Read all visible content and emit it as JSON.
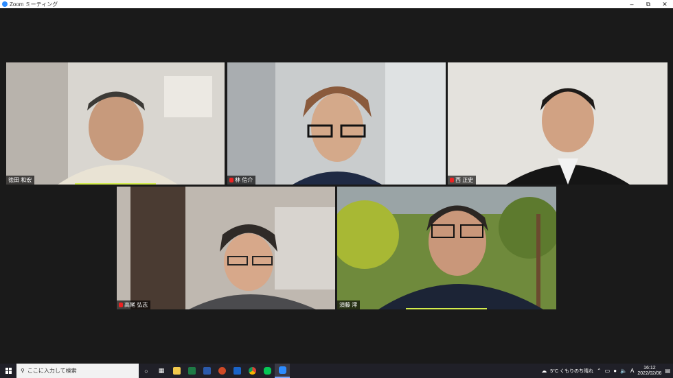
{
  "window": {
    "title": "Zoom ミーティング",
    "minimize": "–",
    "maximize": "⧉",
    "close": "✕"
  },
  "participants": [
    {
      "name": "徳田 和宏",
      "muted": false,
      "active": false
    },
    {
      "name": "林 信介",
      "muted": true,
      "active": false
    },
    {
      "name": "西 正史",
      "muted": true,
      "active": true
    },
    {
      "name": "高尾 弘志",
      "muted": true,
      "active": false
    },
    {
      "name": "須藤 澪",
      "muted": false,
      "active": false
    }
  ],
  "taskbar": {
    "search_placeholder": "ここに入力して検索",
    "apps": [
      "task-view",
      "file-explorer",
      "excel",
      "word",
      "powerpoint",
      "outlook",
      "chrome",
      "line",
      "zoom"
    ],
    "weather": "5°C くもりのち晴れ",
    "ime": "A",
    "time": "16:12",
    "date": "2022/02/06"
  },
  "colors": {
    "active_speaker": "#d3ec4d",
    "taskbar": "#202028",
    "stage": "#1a1a1a"
  }
}
